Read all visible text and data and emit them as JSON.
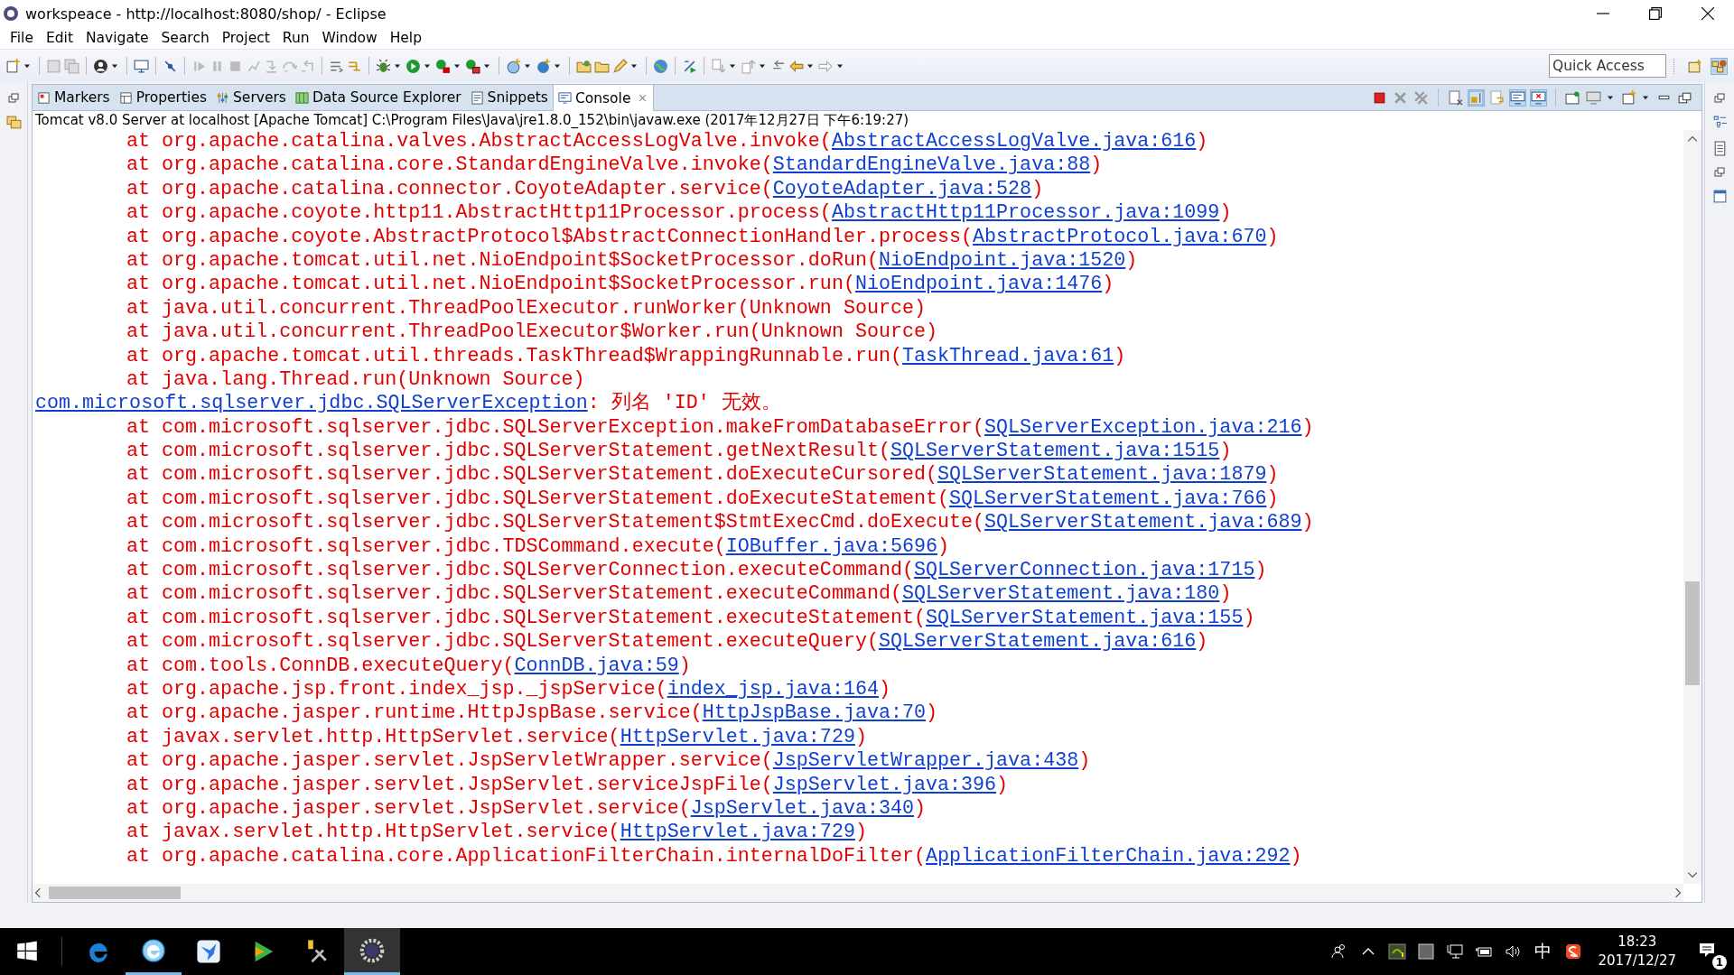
{
  "window": {
    "title": "workspeace - http://localhost:8080/shop/ - Eclipse"
  },
  "menu": [
    "File",
    "Edit",
    "Navigate",
    "Search",
    "Project",
    "Run",
    "Window",
    "Help"
  ],
  "quick_access": {
    "placeholder": "Quick Access"
  },
  "tabs": [
    {
      "label": "Markers",
      "selected": false
    },
    {
      "label": "Properties",
      "selected": false
    },
    {
      "label": "Servers",
      "selected": false
    },
    {
      "label": "Data Source Explorer",
      "selected": false
    },
    {
      "label": "Snippets",
      "selected": false
    },
    {
      "label": "Console",
      "selected": true
    }
  ],
  "console": {
    "header": "Tomcat v8.0 Server at localhost [Apache Tomcat] C:\\Program Files\\Java\\jre1.8.0_152\\bin\\javaw.exe (2017年12月27日 下午6:19:27)",
    "lines": [
      {
        "kind": "frame",
        "parts": [
          {
            "kind": "plain",
            "text": "at org.apache.catalina.valves.AbstractAccessLogValve.invoke("
          },
          {
            "kind": "link",
            "text": "AbstractAccessLogValve.java:616"
          },
          {
            "kind": "plain",
            "text": ")"
          }
        ]
      },
      {
        "kind": "frame",
        "parts": [
          {
            "kind": "plain",
            "text": "at org.apache.catalina.core.StandardEngineValve.invoke("
          },
          {
            "kind": "link",
            "text": "StandardEngineValve.java:88"
          },
          {
            "kind": "plain",
            "text": ")"
          }
        ]
      },
      {
        "kind": "frame",
        "parts": [
          {
            "kind": "plain",
            "text": "at org.apache.catalina.connector.CoyoteAdapter.service("
          },
          {
            "kind": "link",
            "text": "CoyoteAdapter.java:528"
          },
          {
            "kind": "plain",
            "text": ")"
          }
        ]
      },
      {
        "kind": "frame",
        "parts": [
          {
            "kind": "plain",
            "text": "at org.apache.coyote.http11.AbstractHttp11Processor.process("
          },
          {
            "kind": "link",
            "text": "AbstractHttp11Processor.java:1099"
          },
          {
            "kind": "plain",
            "text": ")"
          }
        ]
      },
      {
        "kind": "frame",
        "parts": [
          {
            "kind": "plain",
            "text": "at org.apache.coyote.AbstractProtocol$AbstractConnectionHandler.process("
          },
          {
            "kind": "link",
            "text": "AbstractProtocol.java:670"
          },
          {
            "kind": "plain",
            "text": ")"
          }
        ]
      },
      {
        "kind": "frame",
        "parts": [
          {
            "kind": "plain",
            "text": "at org.apache.tomcat.util.net.NioEndpoint$SocketProcessor.doRun("
          },
          {
            "kind": "link",
            "text": "NioEndpoint.java:1520"
          },
          {
            "kind": "plain",
            "text": ")"
          }
        ]
      },
      {
        "kind": "frame",
        "parts": [
          {
            "kind": "plain",
            "text": "at org.apache.tomcat.util.net.NioEndpoint$SocketProcessor.run("
          },
          {
            "kind": "link",
            "text": "NioEndpoint.java:1476"
          },
          {
            "kind": "plain",
            "text": ")"
          }
        ]
      },
      {
        "kind": "frame",
        "parts": [
          {
            "kind": "plain",
            "text": "at java.util.concurrent.ThreadPoolExecutor.runWorker(Unknown Source)"
          }
        ]
      },
      {
        "kind": "frame",
        "parts": [
          {
            "kind": "plain",
            "text": "at java.util.concurrent.ThreadPoolExecutor$Worker.run(Unknown Source)"
          }
        ]
      },
      {
        "kind": "frame",
        "parts": [
          {
            "kind": "plain",
            "text": "at org.apache.tomcat.util.threads.TaskThread$WrappingRunnable.run("
          },
          {
            "kind": "link",
            "text": "TaskThread.java:61"
          },
          {
            "kind": "plain",
            "text": ")"
          }
        ]
      },
      {
        "kind": "frame",
        "parts": [
          {
            "kind": "plain",
            "text": "at java.lang.Thread.run(Unknown Source)"
          }
        ]
      },
      {
        "kind": "exception",
        "parts": [
          {
            "kind": "link",
            "text": "com.microsoft.sqlserver.jdbc.SQLServerException"
          },
          {
            "kind": "plain",
            "text": ": 列名 'ID' 无效。"
          }
        ]
      },
      {
        "kind": "frame",
        "parts": [
          {
            "kind": "plain",
            "text": "at com.microsoft.sqlserver.jdbc.SQLServerException.makeFromDatabaseError("
          },
          {
            "kind": "link",
            "text": "SQLServerException.java:216"
          },
          {
            "kind": "plain",
            "text": ")"
          }
        ]
      },
      {
        "kind": "frame",
        "parts": [
          {
            "kind": "plain",
            "text": "at com.microsoft.sqlserver.jdbc.SQLServerStatement.getNextResult("
          },
          {
            "kind": "link",
            "text": "SQLServerStatement.java:1515"
          },
          {
            "kind": "plain",
            "text": ")"
          }
        ]
      },
      {
        "kind": "frame",
        "parts": [
          {
            "kind": "plain",
            "text": "at com.microsoft.sqlserver.jdbc.SQLServerStatement.doExecuteCursored("
          },
          {
            "kind": "link",
            "text": "SQLServerStatement.java:1879"
          },
          {
            "kind": "plain",
            "text": ")"
          }
        ]
      },
      {
        "kind": "frame",
        "parts": [
          {
            "kind": "plain",
            "text": "at com.microsoft.sqlserver.jdbc.SQLServerStatement.doExecuteStatement("
          },
          {
            "kind": "link",
            "text": "SQLServerStatement.java:766"
          },
          {
            "kind": "plain",
            "text": ")"
          }
        ]
      },
      {
        "kind": "frame",
        "parts": [
          {
            "kind": "plain",
            "text": "at com.microsoft.sqlserver.jdbc.SQLServerStatement$StmtExecCmd.doExecute("
          },
          {
            "kind": "link",
            "text": "SQLServerStatement.java:689"
          },
          {
            "kind": "plain",
            "text": ")"
          }
        ]
      },
      {
        "kind": "frame",
        "parts": [
          {
            "kind": "plain",
            "text": "at com.microsoft.sqlserver.jdbc.TDSCommand.execute("
          },
          {
            "kind": "link",
            "text": "IOBuffer.java:5696"
          },
          {
            "kind": "plain",
            "text": ")"
          }
        ]
      },
      {
        "kind": "frame",
        "parts": [
          {
            "kind": "plain",
            "text": "at com.microsoft.sqlserver.jdbc.SQLServerConnection.executeCommand("
          },
          {
            "kind": "link",
            "text": "SQLServerConnection.java:1715"
          },
          {
            "kind": "plain",
            "text": ")"
          }
        ]
      },
      {
        "kind": "frame",
        "parts": [
          {
            "kind": "plain",
            "text": "at com.microsoft.sqlserver.jdbc.SQLServerStatement.executeCommand("
          },
          {
            "kind": "link",
            "text": "SQLServerStatement.java:180"
          },
          {
            "kind": "plain",
            "text": ")"
          }
        ]
      },
      {
        "kind": "frame",
        "parts": [
          {
            "kind": "plain",
            "text": "at com.microsoft.sqlserver.jdbc.SQLServerStatement.executeStatement("
          },
          {
            "kind": "link",
            "text": "SQLServerStatement.java:155"
          },
          {
            "kind": "plain",
            "text": ")"
          }
        ]
      },
      {
        "kind": "frame",
        "parts": [
          {
            "kind": "plain",
            "text": "at com.microsoft.sqlserver.jdbc.SQLServerStatement.executeQuery("
          },
          {
            "kind": "link",
            "text": "SQLServerStatement.java:616"
          },
          {
            "kind": "plain",
            "text": ")"
          }
        ]
      },
      {
        "kind": "frame",
        "parts": [
          {
            "kind": "plain",
            "text": "at com.tools.ConnDB.executeQuery("
          },
          {
            "kind": "link",
            "text": "ConnDB.java:59"
          },
          {
            "kind": "plain",
            "text": ")"
          }
        ]
      },
      {
        "kind": "frame",
        "parts": [
          {
            "kind": "plain",
            "text": "at org.apache.jsp.front.index_jsp._jspService("
          },
          {
            "kind": "link",
            "text": "index_jsp.java:164"
          },
          {
            "kind": "plain",
            "text": ")"
          }
        ]
      },
      {
        "kind": "frame",
        "parts": [
          {
            "kind": "plain",
            "text": "at org.apache.jasper.runtime.HttpJspBase.service("
          },
          {
            "kind": "link",
            "text": "HttpJspBase.java:70"
          },
          {
            "kind": "plain",
            "text": ")"
          }
        ]
      },
      {
        "kind": "frame",
        "parts": [
          {
            "kind": "plain",
            "text": "at javax.servlet.http.HttpServlet.service("
          },
          {
            "kind": "link",
            "text": "HttpServlet.java:729"
          },
          {
            "kind": "plain",
            "text": ")"
          }
        ]
      },
      {
        "kind": "frame",
        "parts": [
          {
            "kind": "plain",
            "text": "at org.apache.jasper.servlet.JspServletWrapper.service("
          },
          {
            "kind": "link",
            "text": "JspServletWrapper.java:438"
          },
          {
            "kind": "plain",
            "text": ")"
          }
        ]
      },
      {
        "kind": "frame",
        "parts": [
          {
            "kind": "plain",
            "text": "at org.apache.jasper.servlet.JspServlet.serviceJspFile("
          },
          {
            "kind": "link",
            "text": "JspServlet.java:396"
          },
          {
            "kind": "plain",
            "text": ")"
          }
        ]
      },
      {
        "kind": "frame",
        "parts": [
          {
            "kind": "plain",
            "text": "at org.apache.jasper.servlet.JspServlet.service("
          },
          {
            "kind": "link",
            "text": "JspServlet.java:340"
          },
          {
            "kind": "plain",
            "text": ")"
          }
        ]
      },
      {
        "kind": "frame",
        "parts": [
          {
            "kind": "plain",
            "text": "at javax.servlet.http.HttpServlet.service("
          },
          {
            "kind": "link",
            "text": "HttpServlet.java:729"
          },
          {
            "kind": "plain",
            "text": ")"
          }
        ]
      },
      {
        "kind": "frame",
        "parts": [
          {
            "kind": "plain",
            "text": "at org.apache.catalina.core.ApplicationFilterChain.internalDoFilter("
          },
          {
            "kind": "link",
            "text": "ApplicationFilterChain.java:292"
          },
          {
            "kind": "plain",
            "text": ")"
          }
        ]
      }
    ]
  },
  "taskbar": {
    "ime": "中",
    "time": "18:23",
    "date": "2017/12/27",
    "notifications": "1"
  }
}
